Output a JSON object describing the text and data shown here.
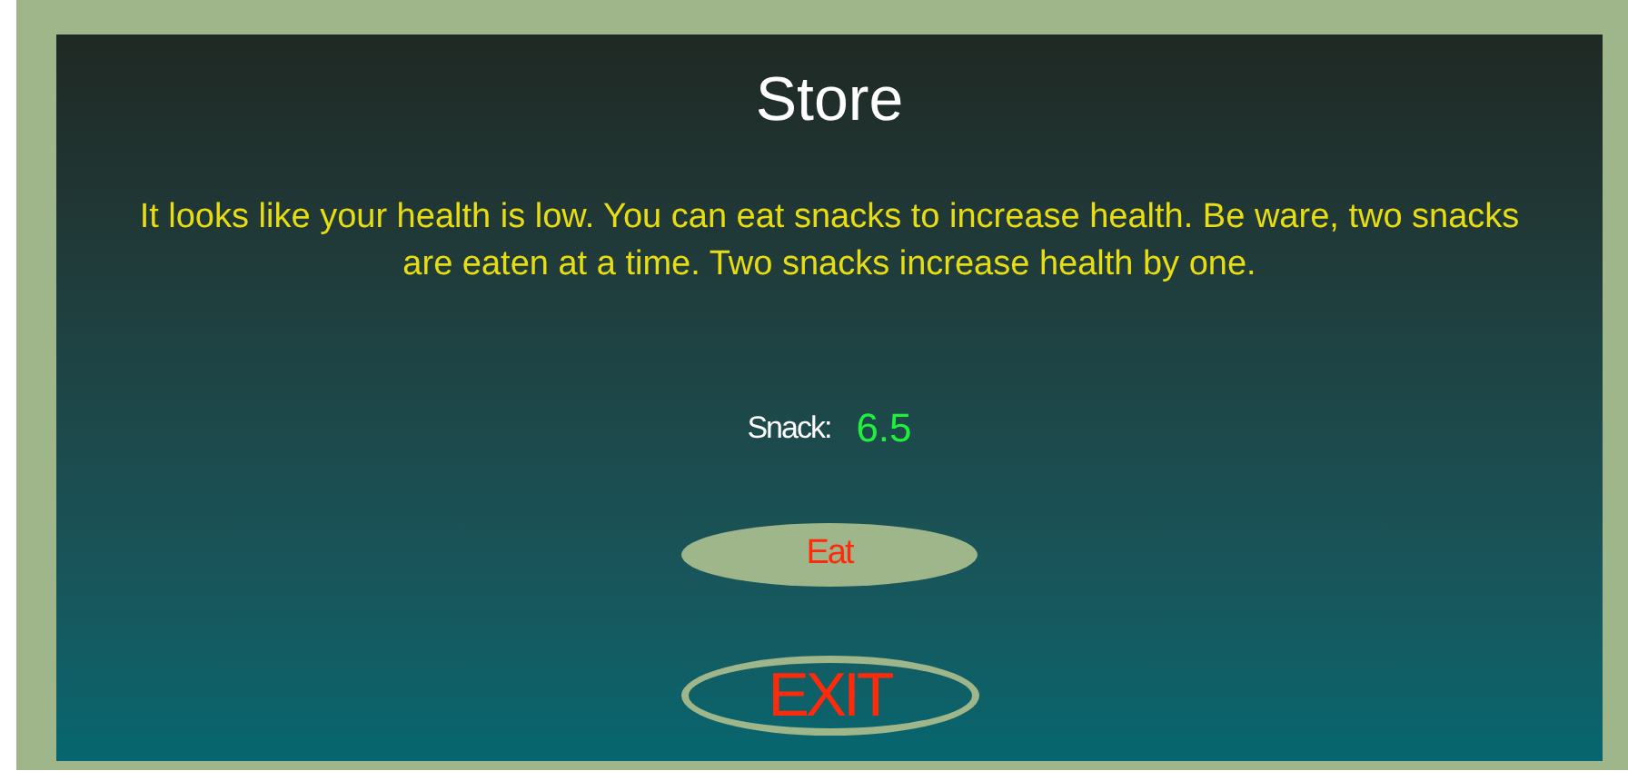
{
  "title": "Store",
  "message": "It looks like your health is low. You can eat snacks to increase health. Be ware, two snacks are eaten at a time. Two snacks increase health by one.",
  "snack": {
    "label": "Snack:",
    "value": "6.5"
  },
  "buttons": [
    {
      "kind": "filled",
      "label": "Eat"
    },
    {
      "kind": "outline",
      "label": "EXIT"
    }
  ]
}
